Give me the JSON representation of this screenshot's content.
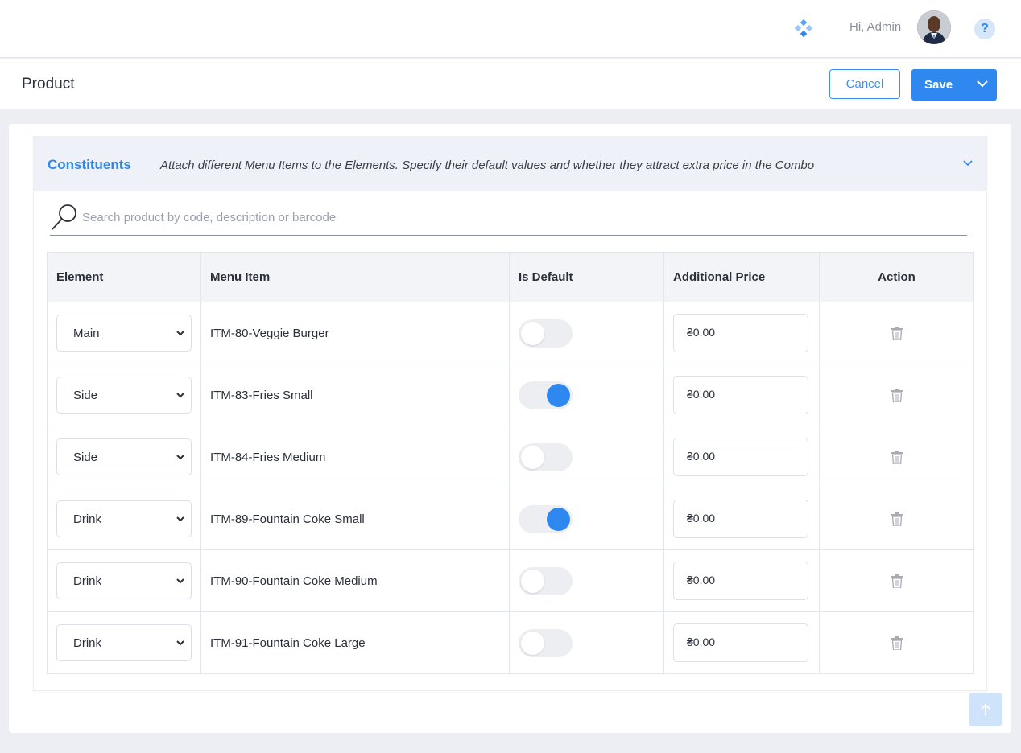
{
  "header": {
    "greeting": "Hi, Admin",
    "apps_icon": "apps-icon",
    "help_label": "?"
  },
  "page": {
    "title": "Product",
    "cancel_label": "Cancel",
    "save_label": "Save"
  },
  "panel": {
    "title": "Constituents",
    "description": "Attach different Menu Items to the Elements. Specify their default values and whether they attract extra price in the Combo"
  },
  "search": {
    "placeholder": "Search product by code, description or barcode",
    "value": ""
  },
  "table": {
    "columns": [
      "Element",
      "Menu Item",
      "Is Default",
      "Additional Price",
      "Action"
    ],
    "rows": [
      {
        "element": "Main",
        "menu_item": "ITM-80-Veggie Burger",
        "is_default": false,
        "price": "₴0.00"
      },
      {
        "element": "Side",
        "menu_item": "ITM-83-Fries Small",
        "is_default": true,
        "price": "₴0.00"
      },
      {
        "element": "Side",
        "menu_item": "ITM-84-Fries Medium",
        "is_default": false,
        "price": "₴0.00"
      },
      {
        "element": "Drink",
        "menu_item": "ITM-89-Fountain Coke Small",
        "is_default": true,
        "price": "₴0.00"
      },
      {
        "element": "Drink",
        "menu_item": "ITM-90-Fountain Coke Medium",
        "is_default": false,
        "price": "₴0.00"
      },
      {
        "element": "Drink",
        "menu_item": "ITM-91-Fountain Coke Large",
        "is_default": false,
        "price": "₴0.00"
      }
    ]
  },
  "colors": {
    "accent": "#2f88f0",
    "toggle_off": "#eceef2",
    "header_bg": "#eef2f8"
  }
}
